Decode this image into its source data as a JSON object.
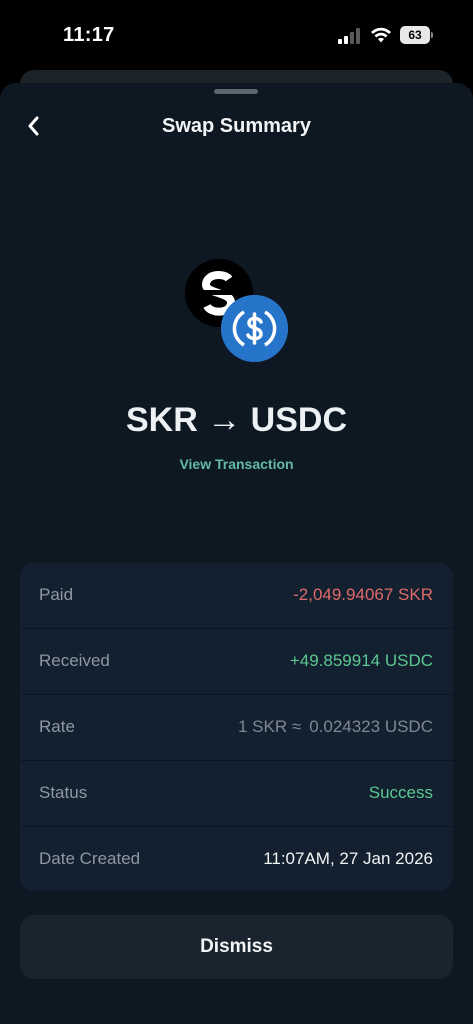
{
  "status_bar": {
    "time": "11:17",
    "battery": "63"
  },
  "header": {
    "title": "Swap Summary",
    "back_icon": "chevron-left-icon"
  },
  "tokens": {
    "from_icon": "skr-token-icon",
    "to_icon": "usdc-token-icon",
    "pair_label": "SKR → USDC"
  },
  "view_transaction_label": "View Transaction",
  "details": {
    "paid": {
      "label": "Paid",
      "value": "-2,049.94067 SKR"
    },
    "received": {
      "label": "Received",
      "value": "+49.859914 USDC"
    },
    "rate": {
      "label": "Rate",
      "value_from": "1 SKR ≈",
      "value_to": "0.024323 USDC"
    },
    "status": {
      "label": "Status",
      "value": "Success"
    },
    "date_created": {
      "label": "Date Created",
      "value": "11:07AM, 27 Jan 2026"
    }
  },
  "dismiss_label": "Dismiss",
  "colors": {
    "sheet_bg": "#0d1822",
    "card_bg": "#122030",
    "negative": "#e06a6a",
    "positive": "#5dc790",
    "link": "#63b8a6",
    "usdc_blue": "#2775ca"
  }
}
